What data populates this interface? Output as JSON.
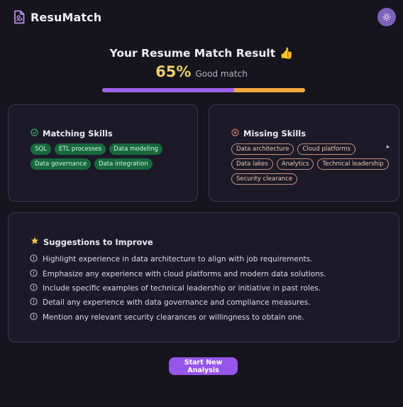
{
  "app": {
    "name": "ResuMatch"
  },
  "result": {
    "title": "Your Resume Match Result",
    "title_emoji": "👍",
    "score_text": "65%",
    "score_value": 65,
    "score_label": "Good match"
  },
  "matching": {
    "title": "Matching Skills",
    "skills": [
      "SQL",
      "ETL processes",
      "Data modeling",
      "Data governance",
      "Data integration"
    ]
  },
  "missing": {
    "title": "Missing Skills",
    "skills": [
      "Data architecture",
      "Cloud platforms",
      "Data lakes",
      "Analytics",
      "Technical leadership",
      "Security clearance"
    ]
  },
  "suggestions": {
    "title": "Suggestions to Improve",
    "items": [
      "Highlight experience in data architecture to align with job requirements.",
      "Emphasize any experience with cloud platforms and modern data solutions.",
      "Include specific examples of technical leadership or initiative in past roles.",
      "Detail any experience with data governance and compliance measures.",
      "Mention any relevant security clearances or willingness to obtain one."
    ]
  },
  "actions": {
    "start_new": "Start New Analysis"
  },
  "colors": {
    "accent": "#9756ea",
    "score": "#efcf6b",
    "bar_remaining": "#f2a93d",
    "match_chip": "#17693c",
    "miss_chip_border": "#c9917a"
  },
  "icons": {
    "logo": "document-icon",
    "theme": "sun-icon",
    "matching": "check-circle-icon",
    "missing": "x-circle-icon",
    "suggestions": "star-icon",
    "suggestion_item": "info-circle-icon"
  }
}
